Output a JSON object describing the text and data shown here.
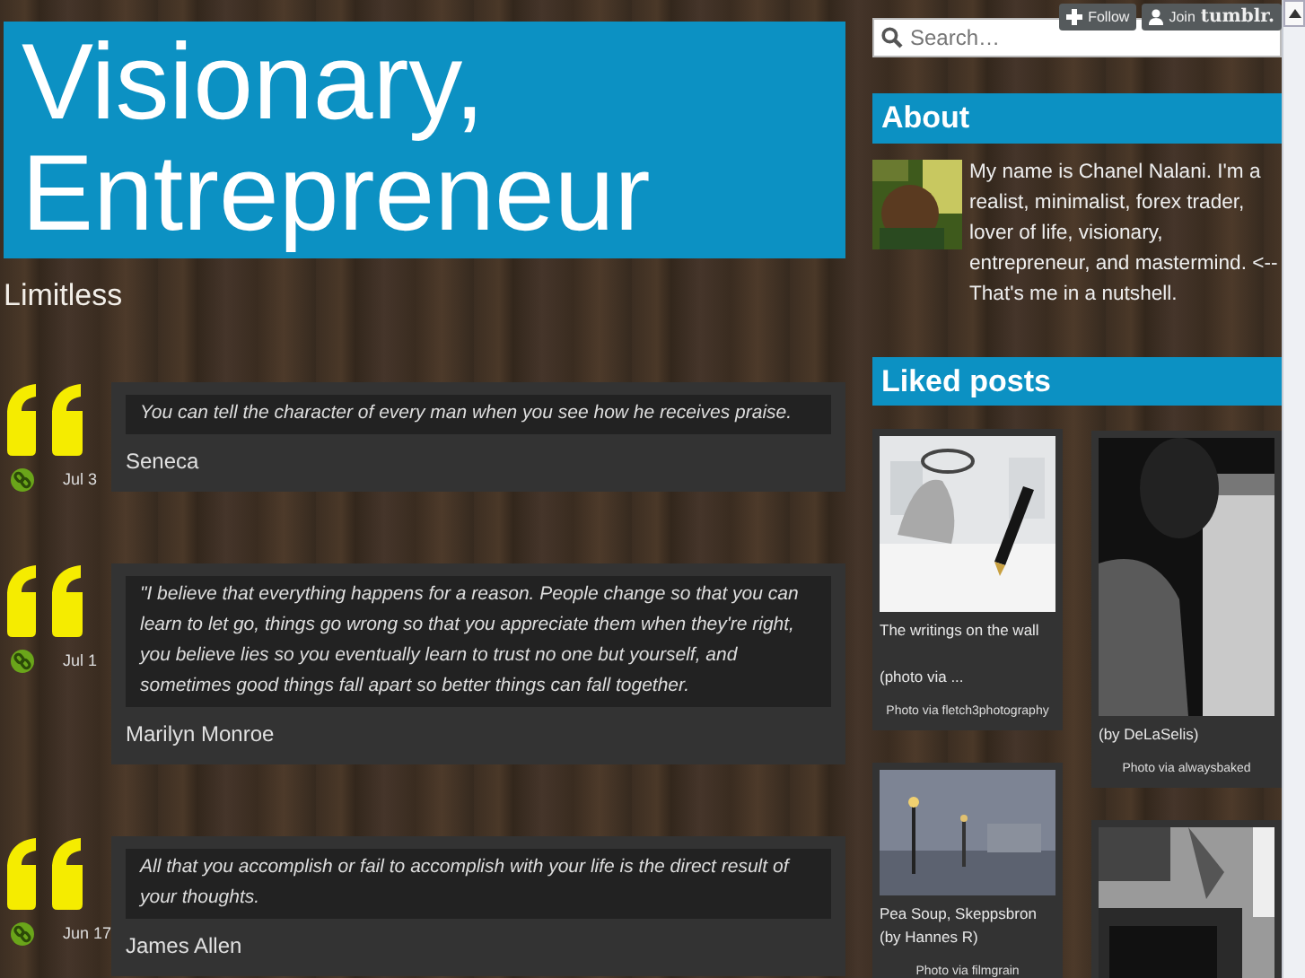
{
  "header": {
    "title": "Visionary, Entrepreneur",
    "description": "Limitless"
  },
  "top_controls": {
    "follow": "Follow",
    "join": "Join",
    "brand": "tumblr."
  },
  "posts": [
    {
      "date": "Jul 3",
      "quote": "You can tell the character of every man when you see how he receives praise.",
      "source": "Seneca"
    },
    {
      "date": "Jul 1",
      "quote": "\"I believe that everything happens for a reason. People change so that you can learn to let go, things go wrong so that you appreciate them when they're right, you believe lies so you eventually learn to trust no one but yourself, and sometimes good things fall apart so better things can fall together.",
      "source": "Marilyn Monroe"
    },
    {
      "date": "Jun 17",
      "quote": "All that you accomplish or fail to accomplish with your life is the direct result of your thoughts.",
      "source": "James Allen"
    }
  ],
  "sidebar": {
    "search": {
      "placeholder": "Search…"
    },
    "about": {
      "heading": "About",
      "text": "My name is Chanel Nalani. I'm a realist, minimalist, forex trader, lover of life, visionary, entrepreneur, and mastermind. <-- That's me in a nutshell."
    },
    "liked": {
      "heading": "Liked posts",
      "items": [
        {
          "caption": [
            "The writings on the wall",
            "(photo via ..."
          ],
          "credit": "Photo via fletch3photography"
        },
        {
          "caption": [
            "(by DeLaSelis)"
          ],
          "credit": "Photo via alwaysbaked"
        },
        {
          "caption": [
            "Pea Soup, Skeppsbron (by Hannes R)"
          ],
          "credit": "Photo via filmgrain"
        },
        {
          "kind": "picture"
        }
      ]
    }
  }
}
